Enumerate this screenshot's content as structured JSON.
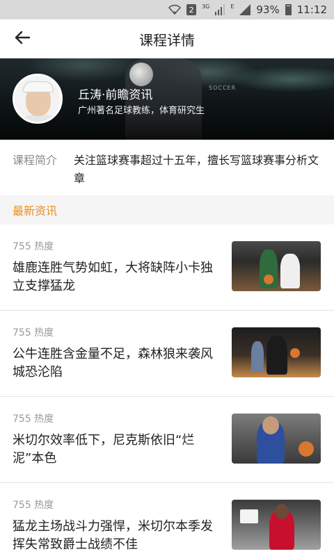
{
  "status_bar": {
    "sim_badge": "2",
    "network_3g": "3G",
    "network_e": "E",
    "battery": "93%",
    "time": "11:12",
    "icons": [
      "wifi-icon",
      "signal-icon",
      "signal-icon",
      "battery-icon"
    ]
  },
  "header": {
    "back_icon": "arrow-left-icon",
    "title": "课程详情"
  },
  "banner": {
    "name": "丘涛·前瞻资讯",
    "description": "广州著名足球教练，体育研究生",
    "ad_text": "SOCCER"
  },
  "intro": {
    "label": "课程简介",
    "text": "关注篮球赛事超过十五年，擅长写篮球赛事分析文章"
  },
  "section": {
    "title": "最新资讯"
  },
  "news": [
    {
      "heat": "755 热度",
      "title": "雄鹿连胜气势如虹，大将缺阵小卡独立支撑猛龙"
    },
    {
      "heat": "755 热度",
      "title": " 公牛连胜含金量不足，森林狼来袭风城恐沦陷"
    },
    {
      "heat": "755 热度",
      "title": "米切尔效率低下，尼克斯依旧“烂泥”本色"
    },
    {
      "heat": "755 热度",
      "title": "猛龙主场战斗力强悍，米切尔本季发挥失常致爵士战绩不佳"
    }
  ],
  "colors": {
    "accent": "#f08a1c",
    "section_bg": "#f5f5f5",
    "status_bar_bg": "#d9d9d9"
  }
}
